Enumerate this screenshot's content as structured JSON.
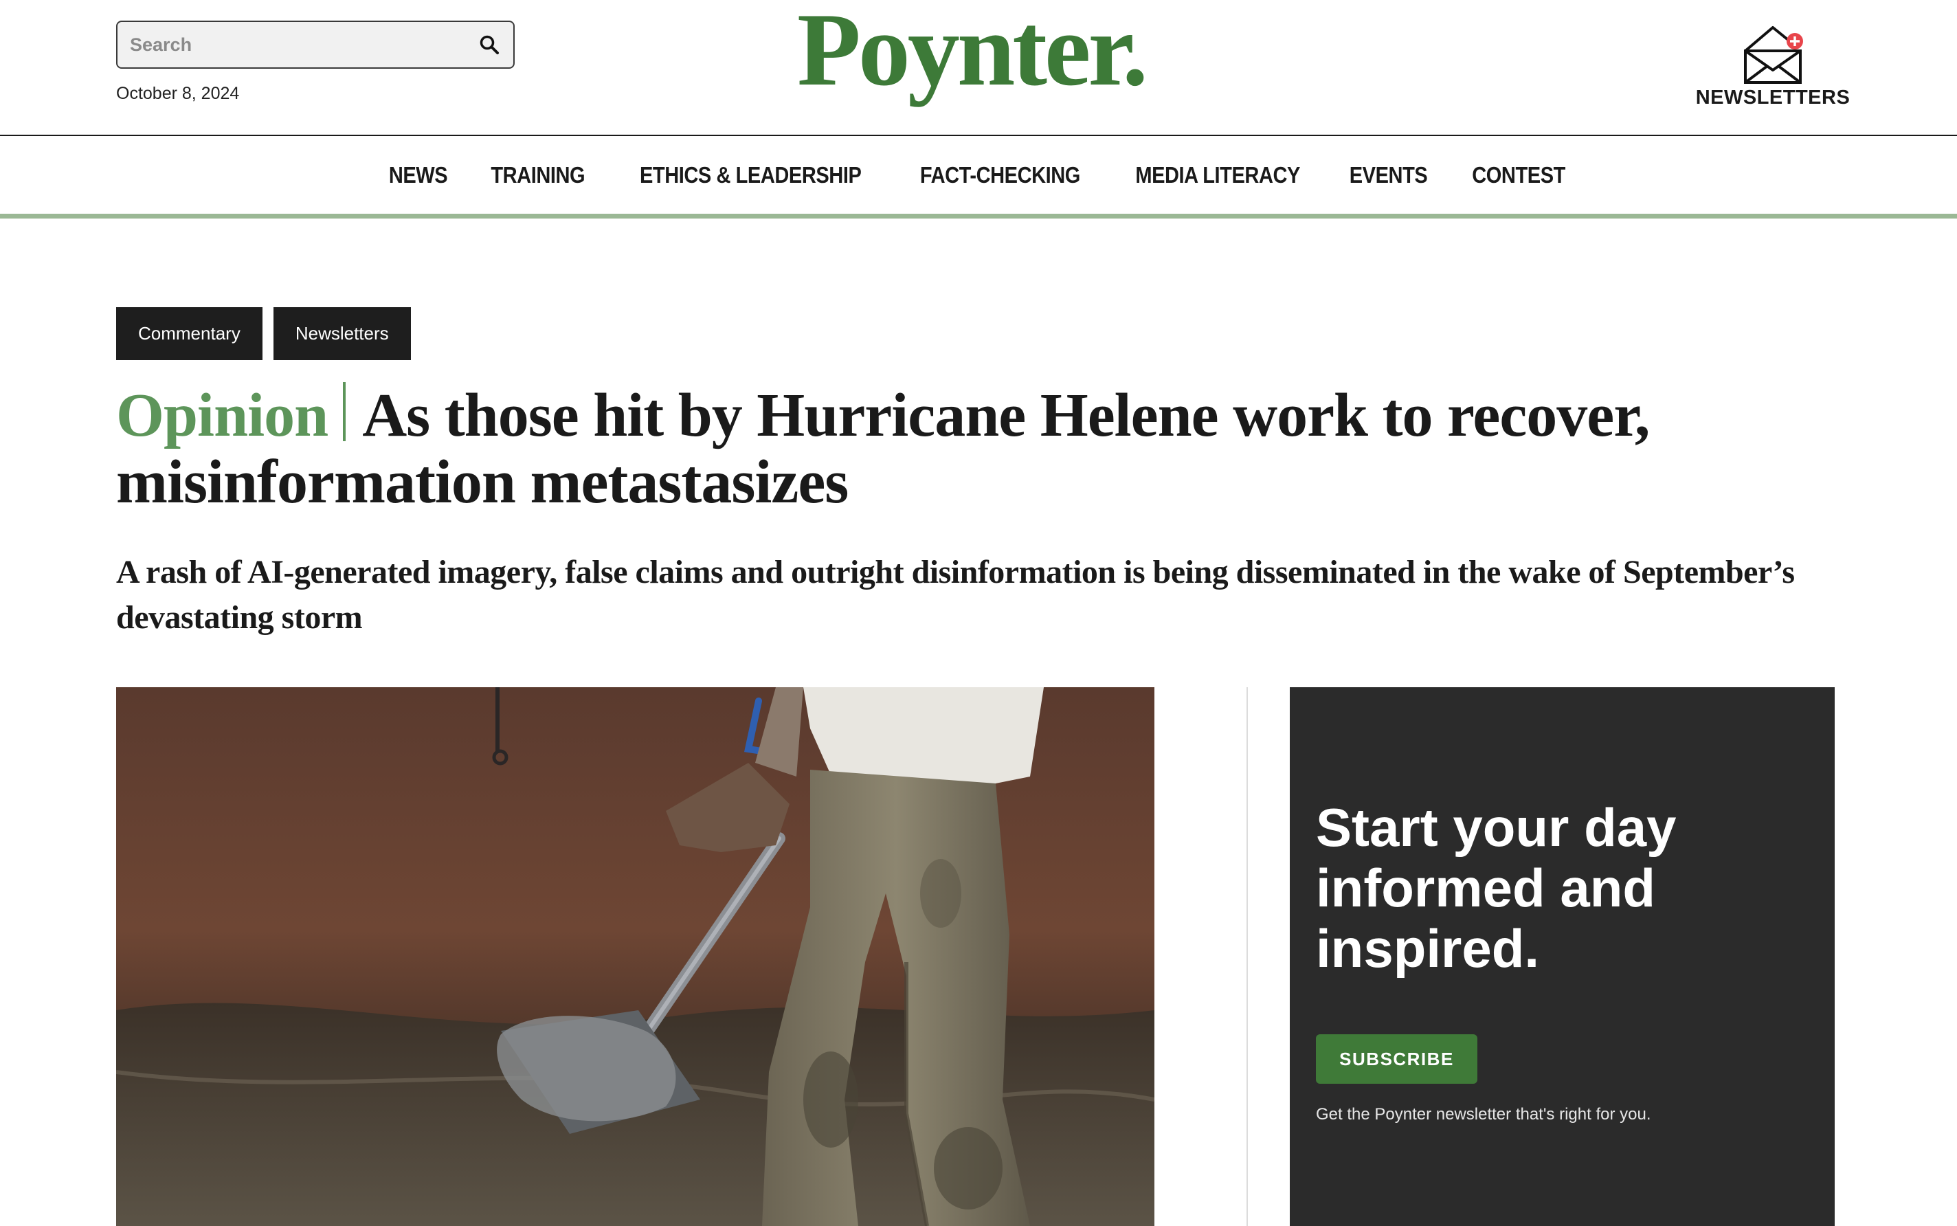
{
  "search": {
    "placeholder": "Search"
  },
  "header": {
    "date": "October 8, 2024",
    "logo": "Poynter.",
    "newsletters_label": "NEWSLETTERS"
  },
  "nav": {
    "items": [
      {
        "label": "NEWS"
      },
      {
        "label": "TRAINING"
      },
      {
        "label": "ETHICS & LEADERSHIP"
      },
      {
        "label": "FACT-CHECKING"
      },
      {
        "label": "MEDIA LITERACY"
      },
      {
        "label": "EVENTS"
      },
      {
        "label": "CONTEST"
      }
    ]
  },
  "article": {
    "tags": [
      {
        "label": "Commentary"
      },
      {
        "label": "Newsletters"
      }
    ],
    "kicker": "Opinion",
    "title": "As those hit by Hurricane Helene work to recover, misinformation metastasizes",
    "subtitle": "A rash of AI-generated imagery, false claims and outright disinformation is being disseminated in the wake of September’s devastating storm"
  },
  "promo": {
    "title": "Start your day informed and inspired.",
    "button_label": "SUBSCRIBE",
    "note": "Get the Poynter newsletter that's right for you."
  },
  "colors": {
    "brand_green": "#3d7a38",
    "opinion_green": "#5d955a",
    "nav_underline": "#9bb895",
    "promo_bg": "#2b2b2b",
    "tag_bg": "#1e1e1e"
  },
  "icons": {
    "search": "search-icon",
    "newsletter": "envelope-icon"
  }
}
